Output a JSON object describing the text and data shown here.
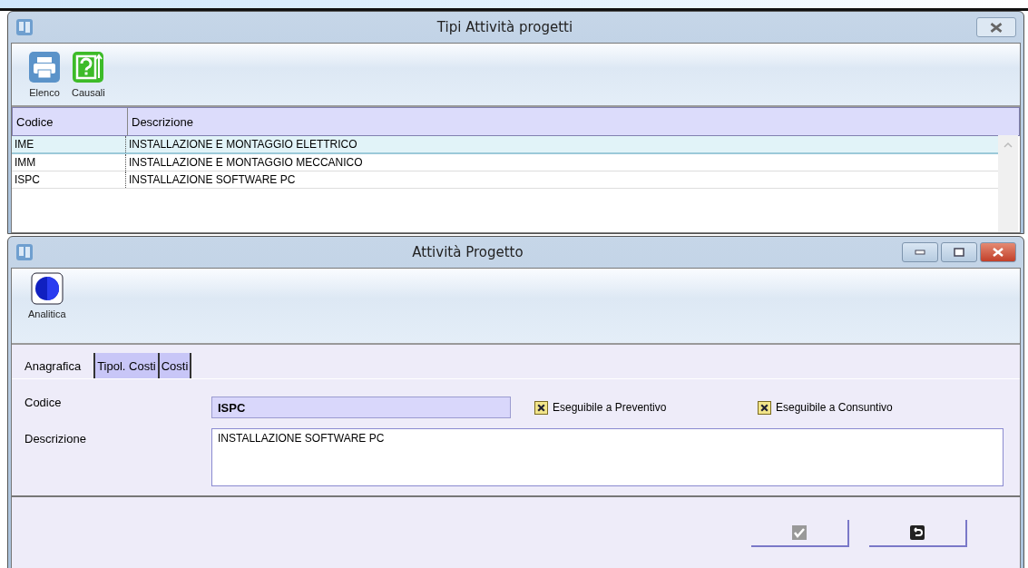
{
  "back_window": {
    "title": "Tipi Attività progetti",
    "toolbar": [
      {
        "label": "Elenco",
        "kind": "print"
      },
      {
        "label": "Causali",
        "kind": "help"
      }
    ],
    "table": {
      "columns": [
        "Codice",
        "Descrizione"
      ],
      "rows": [
        {
          "cells": [
            "IME",
            "INSTALLAZIONE E MONTAGGIO ELETTRICO"
          ],
          "selected": true
        },
        {
          "cells": [
            "IMM",
            "INSTALLAZIONE E MONTAGGIO MECCANICO"
          ],
          "selected": false
        },
        {
          "cells": [
            "ISPC",
            "INSTALLAZIONE SOFTWARE PC"
          ],
          "selected": false
        }
      ]
    }
  },
  "front_window": {
    "title": "Attività Progetto",
    "toolbar": [
      {
        "label": "Analitica",
        "kind": "circle"
      }
    ],
    "tabs": [
      {
        "label": "Anagrafica",
        "selected": true
      },
      {
        "label": "Tipol. Costi",
        "selected": false
      },
      {
        "label": "Costi",
        "selected": false
      }
    ],
    "form": {
      "code_label": "Codice",
      "code_value": "ISPC",
      "description_label": "Descrizione",
      "description_value": "INSTALLAZIONE SOFTWARE PC",
      "checkboxes": [
        {
          "label": "Eseguibile a Preventivo",
          "checked": true
        },
        {
          "label": "Eseguibile a Consuntivo",
          "checked": true
        }
      ]
    },
    "buttons": [
      {
        "kind": "confirm"
      },
      {
        "kind": "undo"
      }
    ]
  }
}
